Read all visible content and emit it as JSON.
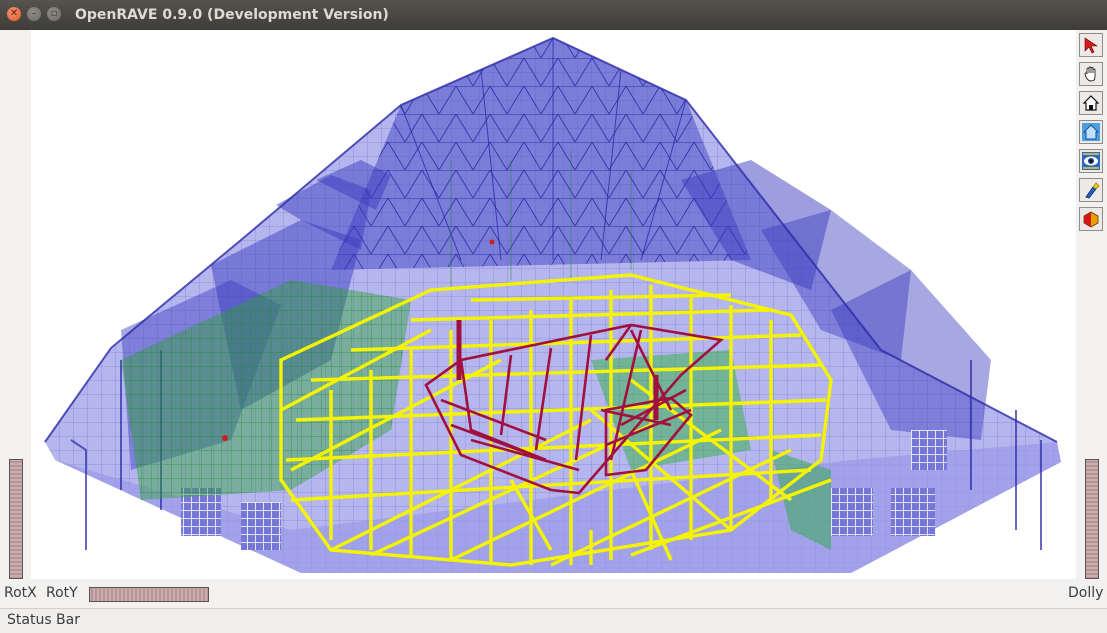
{
  "window": {
    "title": "OpenRAVE 0.9.0 (Development Version)",
    "controls": [
      "close-icon",
      "minimize-icon",
      "maximize-icon"
    ]
  },
  "toolbar": {
    "tools": [
      {
        "name": "select-arrow-icon"
      },
      {
        "name": "pan-hand-icon"
      },
      {
        "name": "home-icon"
      },
      {
        "name": "set-home-icon"
      },
      {
        "name": "view-all-eye-icon"
      },
      {
        "name": "seek-flashlight-icon"
      },
      {
        "name": "perspective-toggle-icon"
      }
    ]
  },
  "controls": {
    "rotx_label": "RotX",
    "roty_label": "RotY",
    "dolly_label": "Dolly"
  },
  "status": {
    "text": "Status Bar"
  },
  "colors": {
    "building_wire": "#2a2aa8",
    "building_fill": "#7c7ce0",
    "robot_yellow": "#f4f400",
    "robot_crimson": "#a01040",
    "green_structure": "#2a9a2a"
  }
}
